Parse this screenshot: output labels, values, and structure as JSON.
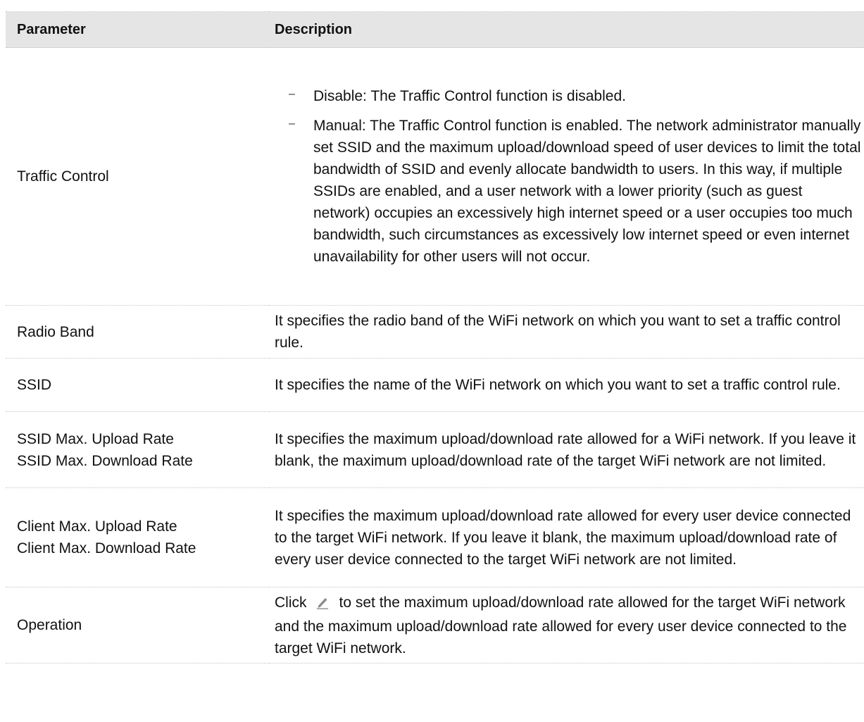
{
  "header": {
    "parameter": "Parameter",
    "description": "Description"
  },
  "rows": {
    "traffic_control": {
      "param": "Traffic Control",
      "bullets": [
        "Disable: The Traffic Control function is disabled.",
        "Manual: The Traffic Control function is enabled. The network administrator manually set SSID and the maximum upload/download speed of user devices to limit the total bandwidth of SSID and evenly allocate bandwidth to users. In this way, if multiple SSIDs are enabled, and a user network with a lower priority (such as guest network) occupies an excessively high internet speed or a user occupies too much bandwidth, such circumstances as excessively low internet speed or even internet unavailability for other users will not occur."
      ]
    },
    "radio_band": {
      "param": "Radio Band",
      "desc": "It specifies the radio band of the WiFi network on which you want to set a traffic control rule."
    },
    "ssid": {
      "param": "SSID",
      "desc": "It specifies the name of the WiFi network on which you want to set a traffic control rule."
    },
    "ssid_rate": {
      "param_upload": "SSID Max. Upload Rate",
      "param_download": "SSID Max. Download Rate",
      "desc": "It specifies the maximum upload/download rate allowed for a WiFi network. If you leave it blank, the maximum upload/download rate of the target WiFi network are not limited."
    },
    "client_rate": {
      "param_upload": "Client Max. Upload Rate",
      "param_download": "Client Max. Download Rate",
      "desc": "It specifies the maximum upload/download rate allowed for every user device connected to the target WiFi network. If you leave it blank, the maximum upload/download rate of every user device connected to the target WiFi network are not limited."
    },
    "operation": {
      "param": "Operation",
      "desc_before": "Click",
      "icon": "edit-icon",
      "desc_after": "to set the maximum upload/download rate allowed for the target WiFi network and the maximum upload/download rate allowed for every user device connected to the target WiFi network."
    }
  },
  "bullet_mark": "–"
}
